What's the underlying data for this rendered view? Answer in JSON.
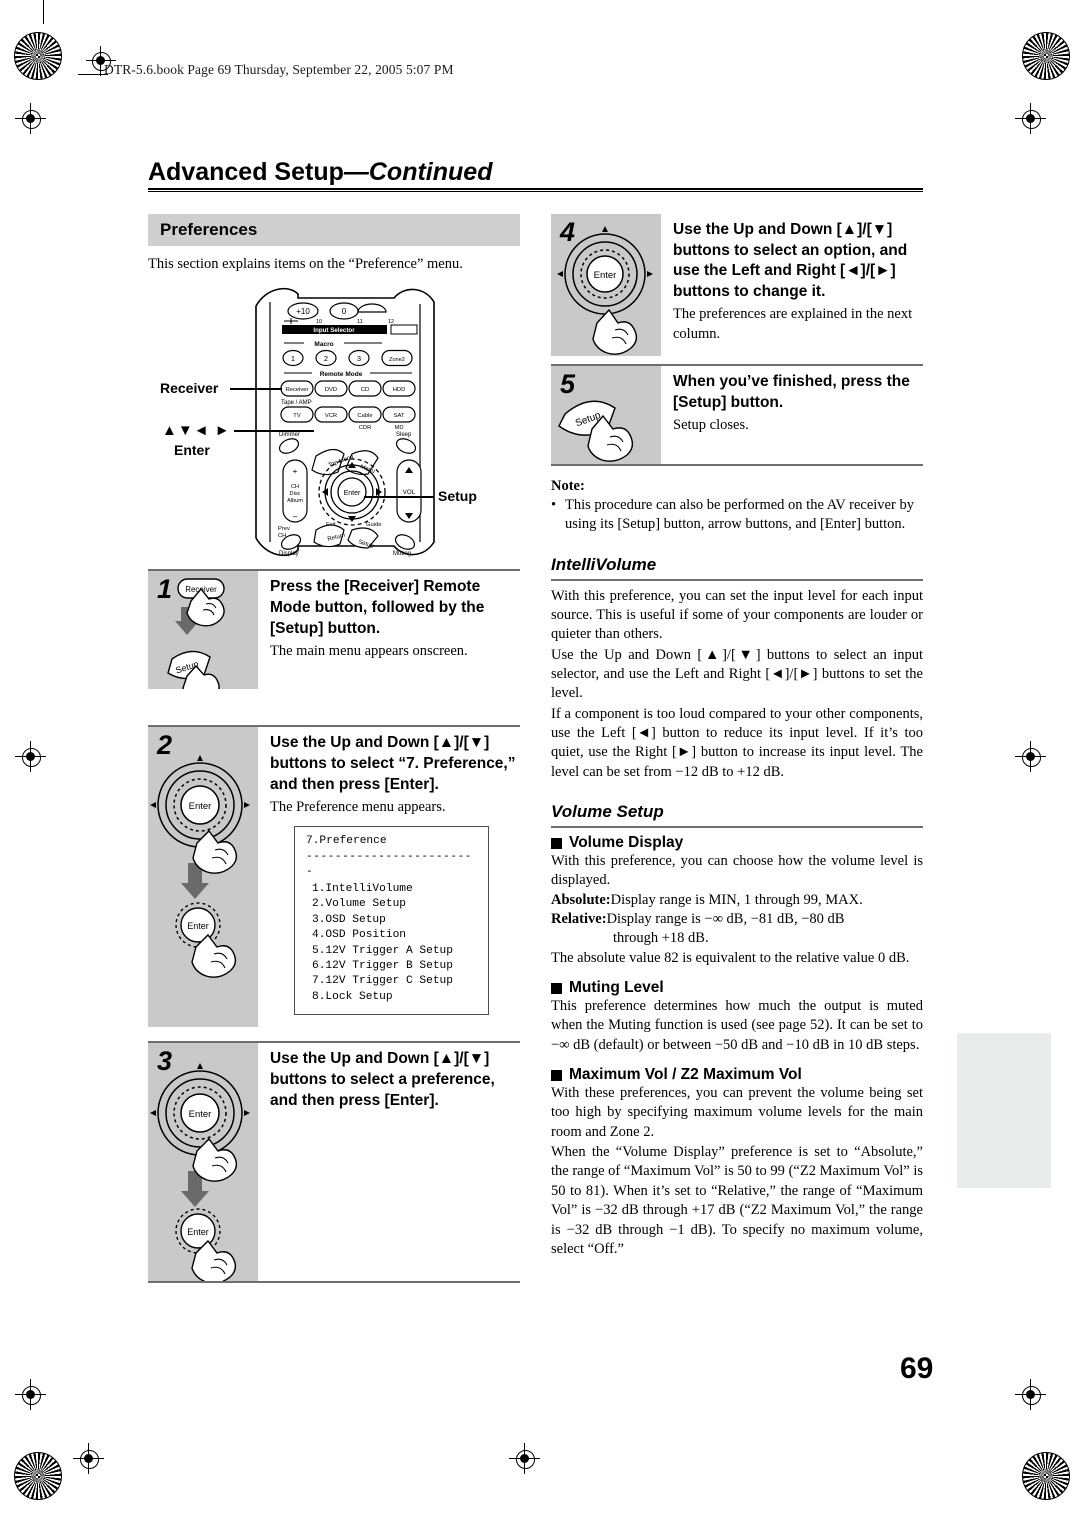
{
  "printmark": {
    "book_line": "DTR-5.6.book  Page 69  Thursday, September 22, 2005  5:07 PM"
  },
  "header": {
    "chapter_title": "Advanced Setup",
    "chapter_continued": "—Continued"
  },
  "page_number": "69",
  "left_column": {
    "section_band": "Preferences",
    "intro": "This section explains items on the “Preference” menu.",
    "remote_labels": {
      "receiver": "Receiver",
      "arrows": "▲▼◄ ►",
      "enter": "Enter",
      "setup": "Setup"
    },
    "remote_buttons": {
      "plus_ten": "+10",
      "zero": "0",
      "num10": "10",
      "num11": "11",
      "num12": "12",
      "input_selector": "Input Selector",
      "macro": "Macro",
      "macro1": "1",
      "macro2": "2",
      "macro3": "3",
      "zone2": "Zone2",
      "remote_mode": "Remote Mode",
      "receiver": "Receiver",
      "dvd": "DVD",
      "cd": "CD",
      "hdd": "HDD",
      "tape_amp": "Tape / AMP",
      "tv": "TV",
      "vcr": "VCR",
      "cable": "Cable",
      "sat": "SAT",
      "cdr": "CDR",
      "md": "MD",
      "dimmer": "Dimmer",
      "sleep": "Sleep",
      "top_menu": "Top Menu",
      "menu": "Menu",
      "ch": "CH",
      "disc": "Disc",
      "album": "Album",
      "vol": "VOL",
      "enter": "Enter",
      "prev_ch": "Prev CH",
      "exit": "Exit",
      "guide": "Guide",
      "return": "Return",
      "setup": "Setup",
      "display": "Display",
      "muting": "Muting",
      "plus": "+",
      "minus": "–"
    },
    "steps": [
      {
        "number": "1",
        "title": "Press the [Receiver] Remote Mode button, followed by the [Setup] button.",
        "sub": "The main menu appears onscreen.",
        "graphic_buttons": [
          "Receiver",
          "Setup"
        ]
      },
      {
        "number": "2",
        "title": "Use the Up and Down [▲]/[▼] buttons to select “7. Preference,” and then press [Enter].",
        "sub": "The Preference menu appears.",
        "graphic_buttons": [
          "Enter",
          "Enter"
        ]
      },
      {
        "number": "3",
        "title": "Use the Up and Down [▲]/[▼] buttons to select a preference, and then press [Enter].",
        "sub": "",
        "graphic_buttons": [
          "Enter",
          "Enter"
        ]
      }
    ],
    "osd_screen": {
      "title": "7.Preference",
      "divider": "------------------------",
      "items": [
        "1.IntelliVolume",
        "2.Volume Setup",
        "3.OSD Setup",
        "4.OSD Position",
        "5.12V Trigger A Setup",
        "6.12V Trigger B Setup",
        "7.12V Trigger C Setup",
        "8.Lock Setup"
      ]
    }
  },
  "right_column": {
    "steps": [
      {
        "number": "4",
        "title": "Use the Up and Down [▲]/[▼] buttons to select an option, and use the Left and Right [◄]/[►] buttons to change it.",
        "sub": "The preferences are explained in the next column.",
        "graphic_buttons": [
          "Enter"
        ]
      },
      {
        "number": "5",
        "title": "When you’ve finished, press the [Setup] button.",
        "sub": "Setup closes.",
        "graphic_buttons": [
          "Setup"
        ]
      }
    ],
    "note": {
      "heading": "Note:",
      "bullet": "This procedure can also be performed on the AV receiver by using its [Setup] button, arrow buttons, and [Enter] button."
    },
    "intellivolume": {
      "heading": "IntelliVolume",
      "paragraphs": [
        "With this preference, you can set the input level for each input source. This is useful if some of your components are louder or quieter than others.",
        "Use the Up and Down [▲]/[▼] buttons to select an input selector, and use the Left and Right [◄]/[►] buttons to set the level.",
        "If a component is too loud compared to your other components, use the Left [◄] button to reduce its input level. If it’s too quiet, use the Right [►] button to increase its input level. The level can be set from −12 dB to +12 dB."
      ]
    },
    "volume_setup": {
      "heading": "Volume Setup",
      "blocks": [
        {
          "sub_heading": "Volume Display",
          "paragraphs": [
            "With this preference, you can choose how the volume level is displayed."
          ],
          "definitions": [
            {
              "term": "Absolute:",
              "text": "Display range is MIN, 1 through 99, MAX."
            },
            {
              "term": "Relative:",
              "text": "Display range is −∞ dB, −81 dB, −80 dB",
              "cont": "through +18 dB."
            }
          ],
          "after": "The absolute value 82 is equivalent to the relative value 0 dB."
        },
        {
          "sub_heading": "Muting Level",
          "paragraphs": [
            "This preference determines how much the output is muted when the Muting function is used (see page 52). It can be set to −∞ dB (default) or between −50 dB and −10 dB in 10 dB steps."
          ]
        },
        {
          "sub_heading": "Maximum Vol / Z2 Maximum Vol",
          "paragraphs": [
            "With these preferences, you can prevent the volume being set too high by specifying maximum volume levels for the main room and Zone 2.",
            "When the “Volume Display” preference is set to “Absolute,” the range of “Maximum Vol” is 50 to 99 (“Z2 Maximum Vol” is 50 to 81). When it’s set to “Relative,” the range of “Maximum Vol” is −32 dB through +17 dB (“Z2 Maximum Vol,” the range is −32 dB through −1 dB). To specify no maximum volume, select “Off.”"
          ]
        }
      ]
    }
  },
  "colors": {
    "band_gray": "#cfcfcf",
    "step_gray": "#c9c9c9",
    "rule_gray": "#6f6f6f",
    "sidetab": "#e8eceb"
  }
}
